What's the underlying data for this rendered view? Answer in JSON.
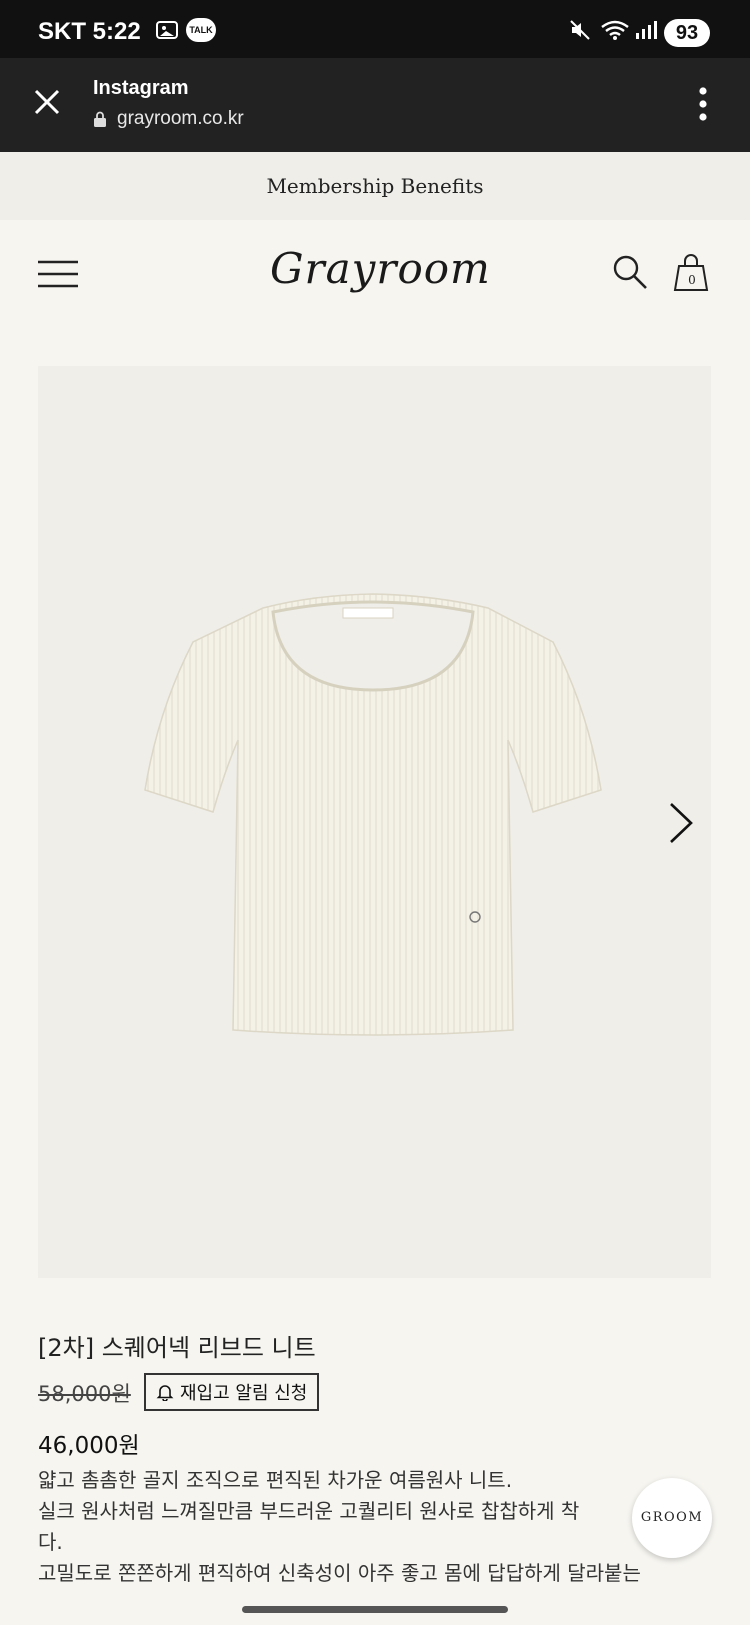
{
  "status_bar": {
    "carrier": "SKT",
    "time": "5:22",
    "talk_badge": "TALK",
    "battery": "93"
  },
  "browser": {
    "title": "Instagram",
    "url": "grayroom.co.kr",
    "icons": [
      "close-icon",
      "lock-icon",
      "more-vertical-icon"
    ]
  },
  "banner": {
    "text": "Membership Benefits"
  },
  "header": {
    "logo": "Grayroom",
    "cart_count": "0",
    "icons": [
      "hamburger-menu-icon",
      "search-icon",
      "shopping-bag-icon"
    ]
  },
  "product": {
    "name": "[2차] 스퀘어넥 리브드 니트",
    "original_price": "58,000원",
    "restock_label": "재입고 알림 신청",
    "sale_price": "46,000원",
    "description": [
      "얇고 촘촘한 골지 조직으로 편직된 차가운 여름원사 니트.",
      "실크 원사처럼 느껴질만큼 부드러운 고퀄리티 원사로 찹찹하게 착",
      "다.",
      "고밀도로 쫀쫀하게 편직하여 신축성이 아주 좋고 몸에 답답하게 달라붙는"
    ]
  },
  "floating": {
    "groom_label": "GROOM"
  },
  "colors": {
    "page_bg": "#f6f5f0",
    "status_bar_bg": "#111111",
    "browser_bar_bg": "#222222",
    "banner_bg": "#efeee9",
    "image_bg": "#efeee9"
  }
}
